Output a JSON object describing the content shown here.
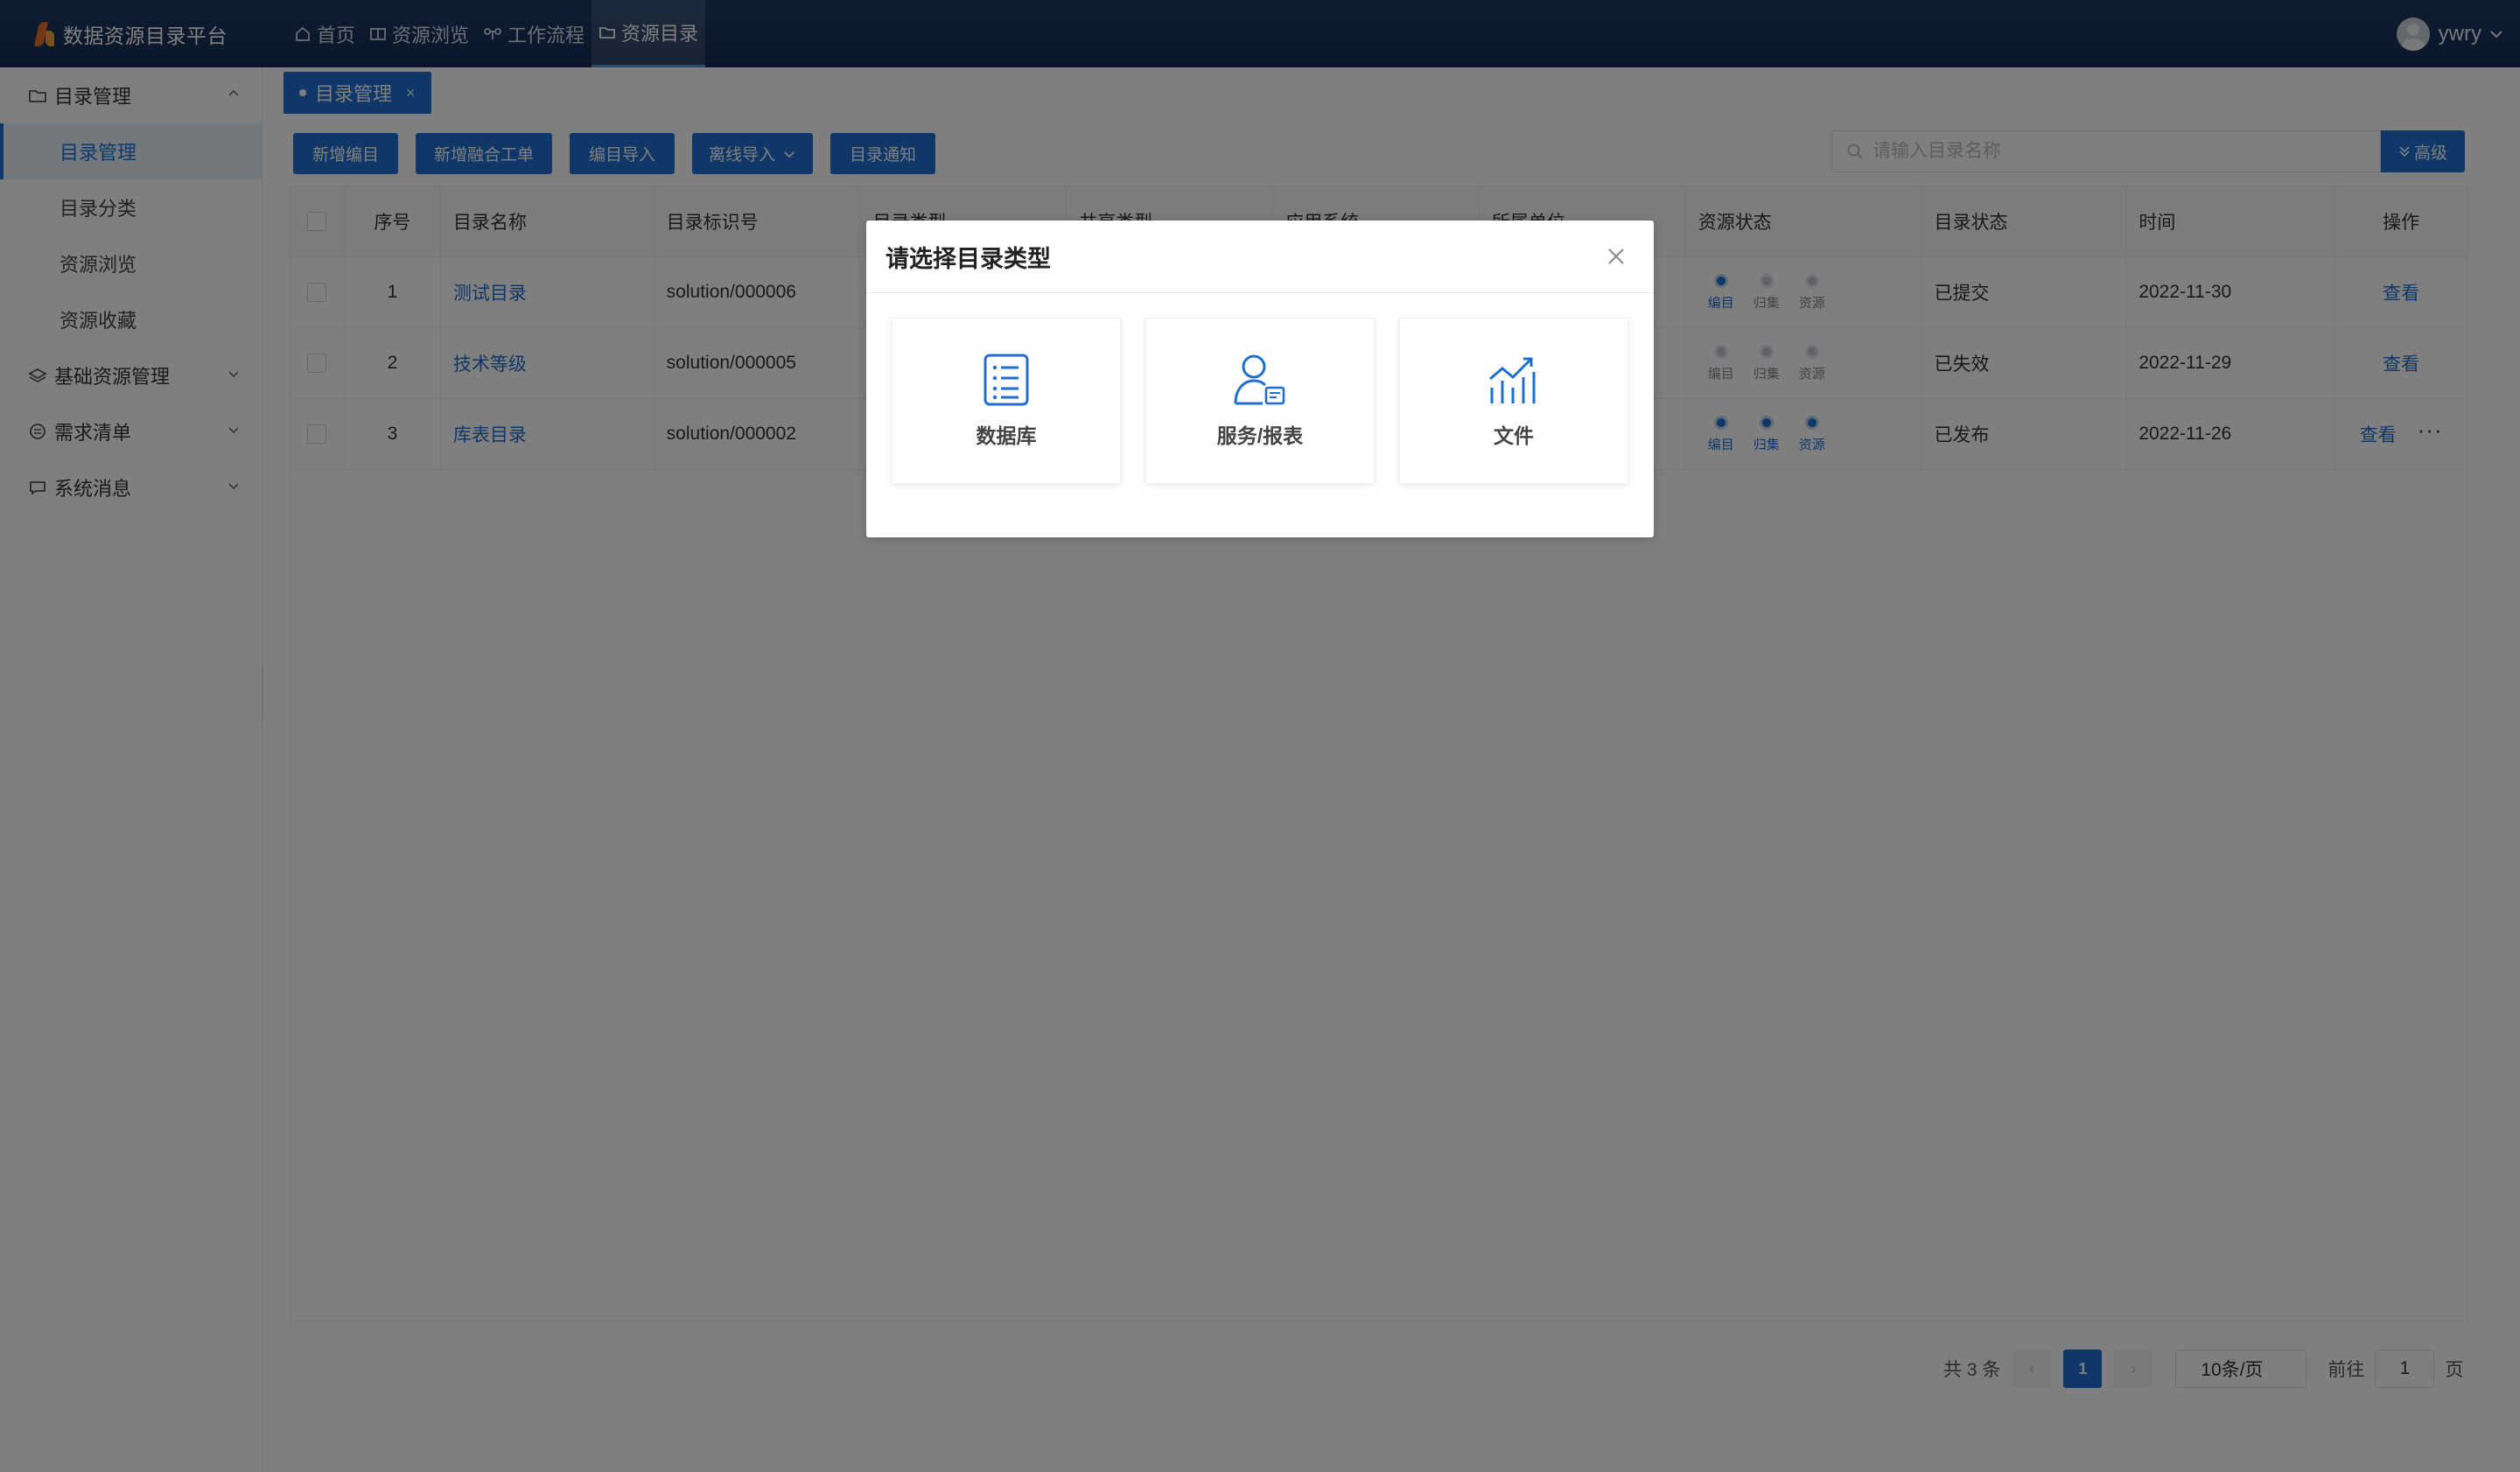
{
  "app": {
    "title": "数据资源目录平台"
  },
  "nav": [
    {
      "label": "首页",
      "icon": "home-icon"
    },
    {
      "label": "资源浏览",
      "icon": "book-icon"
    },
    {
      "label": "工作流程",
      "icon": "workflow-icon"
    },
    {
      "label": "资源目录",
      "icon": "folder-icon",
      "active": true
    }
  ],
  "user": {
    "name": "ywry"
  },
  "sidebar": {
    "groups": [
      {
        "label": "目录管理",
        "icon": "folder-icon",
        "expanded": true,
        "items": [
          {
            "label": "目录管理",
            "active": true
          },
          {
            "label": "目录分类"
          },
          {
            "label": "资源浏览"
          },
          {
            "label": "资源收藏"
          }
        ]
      },
      {
        "label": "基础资源管理",
        "icon": "layers-icon",
        "expanded": false
      },
      {
        "label": "需求清单",
        "icon": "grid-icon",
        "expanded": false
      },
      {
        "label": "系统消息",
        "icon": "chat-icon",
        "expanded": false
      }
    ]
  },
  "tab": {
    "label": "目录管理",
    "close": "×"
  },
  "toolbar": {
    "add_catalog": "新增编目",
    "add_merge_order": "新增融合工单",
    "import_catalog": "编目导入",
    "offline_import": "离线导入",
    "notify": "目录通知"
  },
  "search": {
    "placeholder": "请输入目录名称",
    "advanced": "高级"
  },
  "table": {
    "columns": [
      "序号",
      "目录名称",
      "目录标识号",
      "目录类型",
      "共享类型",
      "应用系统",
      "所属单位",
      "资源状态",
      "目录状态",
      "时间",
      "操作"
    ],
    "step_labels": [
      "编目",
      "归集",
      "资源"
    ],
    "rows": [
      {
        "index": "1",
        "name": "测试目录",
        "id": "solution/000006",
        "steps": [
          true,
          false,
          false
        ],
        "status": "已提交",
        "time": "2022-11-30",
        "action": "查看",
        "more": false
      },
      {
        "index": "2",
        "name": "技术等级",
        "id": "solution/000005",
        "steps": [
          false,
          false,
          false
        ],
        "status": "已失效",
        "time": "2022-11-29",
        "action": "查看",
        "more": false
      },
      {
        "index": "3",
        "name": "库表目录",
        "id": "solution/000002",
        "steps": [
          true,
          true,
          true
        ],
        "status": "已发布",
        "time": "2022-11-26",
        "action": "查看",
        "more": true
      }
    ]
  },
  "pager": {
    "total": "共 3 条",
    "current": "1",
    "size": "10条/页",
    "goto": "前往",
    "page_value": "1",
    "page_unit": "页"
  },
  "modal": {
    "title": "请选择目录类型",
    "options": [
      {
        "label": "数据库",
        "icon": "list-icon"
      },
      {
        "label": "服务/报表",
        "icon": "user-report-icon"
      },
      {
        "label": "文件",
        "icon": "chart-icon"
      }
    ]
  },
  "colors": {
    "primary": "#1f6fcf",
    "topbar": "#1e3a66"
  }
}
